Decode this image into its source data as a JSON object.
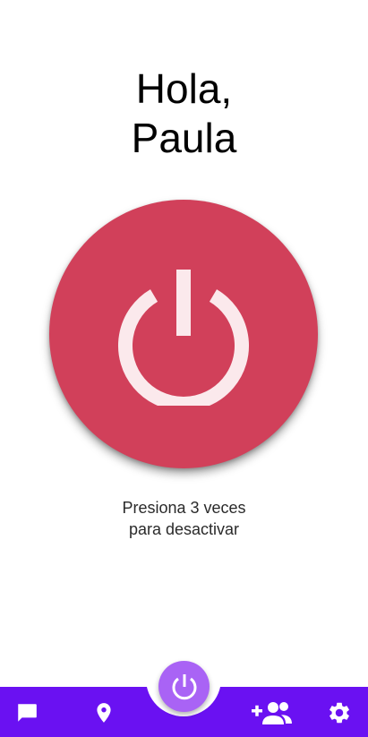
{
  "greeting": {
    "line1": "Hola,",
    "line2": "Paula"
  },
  "power_button": {
    "icon": "power-icon",
    "color": "#d1405a",
    "icon_color": "#fbe9ec"
  },
  "instructions": {
    "line1": "Presiona 3 veces",
    "line2": "para desactivar"
  },
  "bottom_nav": {
    "background": "#6a11f2",
    "fab_color": "#a963f5",
    "items": [
      {
        "icon": "chat-icon"
      },
      {
        "icon": "location-pin-icon"
      },
      {
        "icon": "power-icon"
      },
      {
        "icon": "add-people-icon"
      },
      {
        "icon": "gear-icon"
      }
    ]
  }
}
